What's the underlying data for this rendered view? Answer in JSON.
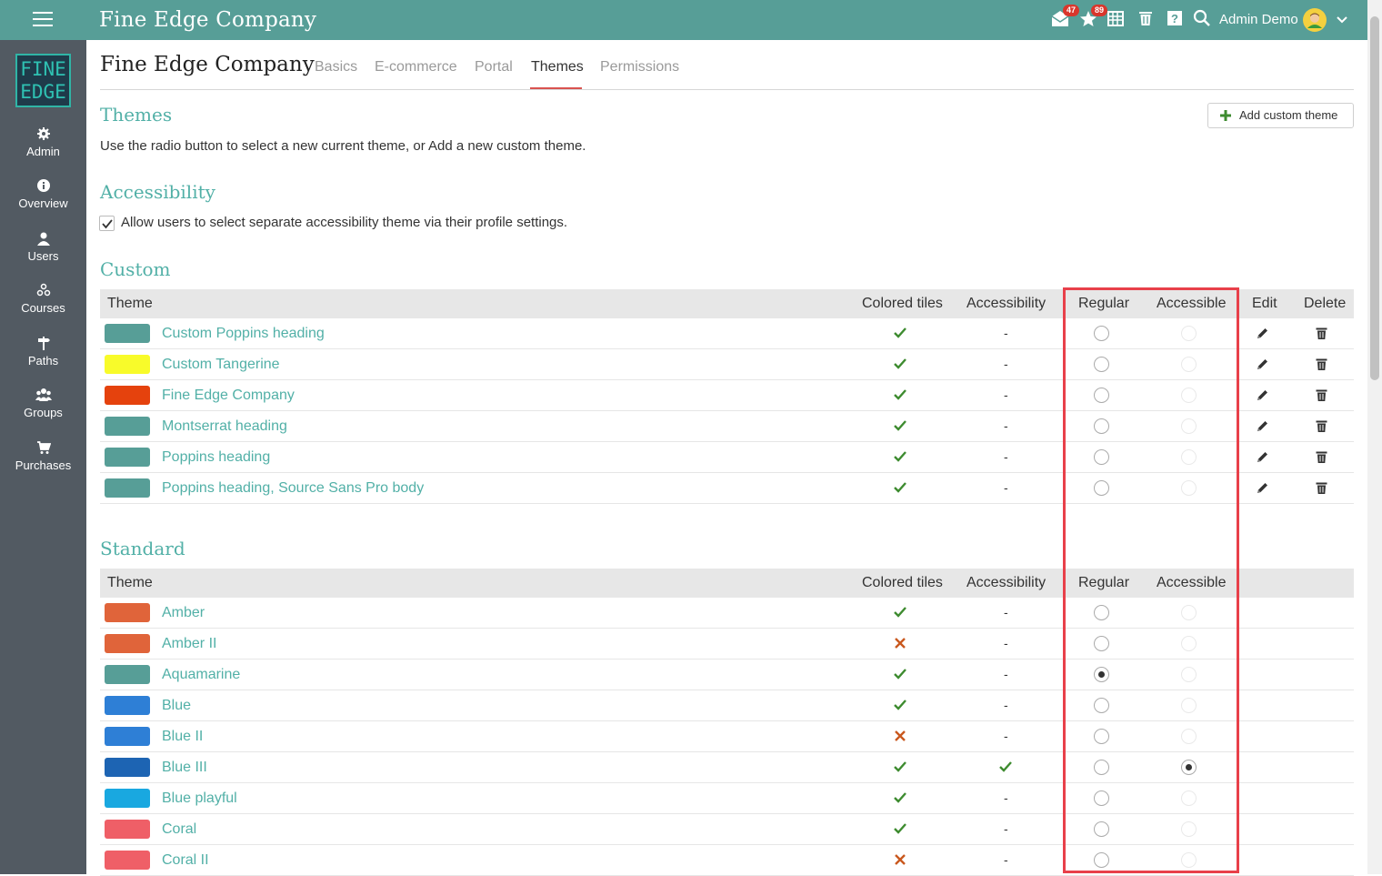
{
  "topbar": {
    "brand": "Fine Edge Company",
    "messages_badge": "47",
    "notifications_badge": "89",
    "user_name": "Admin Demo",
    "color": "#579e97"
  },
  "sidebar": {
    "logo_line1": "FINE",
    "logo_line2": "EDGE",
    "items": [
      {
        "label": "Admin",
        "icon": "gear-icon"
      },
      {
        "label": "Overview",
        "icon": "info-icon"
      },
      {
        "label": "Users",
        "icon": "user-icon"
      },
      {
        "label": "Courses",
        "icon": "courses-icon"
      },
      {
        "label": "Paths",
        "icon": "signpost-icon"
      },
      {
        "label": "Groups",
        "icon": "group-icon"
      },
      {
        "label": "Purchases",
        "icon": "cart-icon"
      }
    ]
  },
  "header": {
    "title": "Fine Edge Company",
    "tabs": [
      "Basics",
      "E-commerce",
      "Portal",
      "Themes",
      "Permissions"
    ],
    "active_tab": "Themes"
  },
  "themes_section": {
    "title": "Themes",
    "description": "Use the radio button to select a new current theme, or Add a new custom theme.",
    "add_button": "Add custom theme"
  },
  "accessibility_section": {
    "title": "Accessibility",
    "checkbox_label": "Allow users to select separate accessibility theme via their profile settings.",
    "checked": true
  },
  "columns": {
    "theme": "Theme",
    "colored_tiles": "Colored tiles",
    "accessibility": "Accessibility",
    "regular": "Regular",
    "accessible": "Accessible",
    "edit": "Edit",
    "delete": "Delete"
  },
  "custom": {
    "title": "Custom",
    "rows": [
      {
        "name": "Custom Poppins heading",
        "color": "#579e97",
        "tiles": true,
        "accessibility": "-",
        "regular": false,
        "accessible": false
      },
      {
        "name": "Custom Tangerine",
        "color": "#f8fb2a",
        "tiles": true,
        "accessibility": "-",
        "regular": false,
        "accessible": false
      },
      {
        "name": "Fine Edge Company",
        "color": "#e5420d",
        "tiles": true,
        "accessibility": "-",
        "regular": false,
        "accessible": false
      },
      {
        "name": "Montserrat heading",
        "color": "#579e97",
        "tiles": true,
        "accessibility": "-",
        "regular": false,
        "accessible": false
      },
      {
        "name": "Poppins heading",
        "color": "#579e97",
        "tiles": true,
        "accessibility": "-",
        "regular": false,
        "accessible": false
      },
      {
        "name": "Poppins heading, Source Sans Pro body",
        "color": "#579e97",
        "tiles": true,
        "accessibility": "-",
        "regular": false,
        "accessible": false
      }
    ]
  },
  "standard": {
    "title": "Standard",
    "rows": [
      {
        "name": "Amber",
        "color": "#e0643a",
        "tiles": true,
        "accessibility": "-",
        "regular": false,
        "accessible": false
      },
      {
        "name": "Amber II",
        "color": "#e0643a",
        "tiles": false,
        "accessibility": "-",
        "regular": false,
        "accessible": false
      },
      {
        "name": "Aquamarine",
        "color": "#579e97",
        "tiles": true,
        "accessibility": "-",
        "regular": true,
        "accessible": false
      },
      {
        "name": "Blue",
        "color": "#2e7fd6",
        "tiles": true,
        "accessibility": "-",
        "regular": false,
        "accessible": false
      },
      {
        "name": "Blue II",
        "color": "#2e7fd6",
        "tiles": false,
        "accessibility": "-",
        "regular": false,
        "accessible": false
      },
      {
        "name": "Blue III",
        "color": "#1d64b3",
        "tiles": true,
        "accessibility": "check",
        "regular": false,
        "accessible": true
      },
      {
        "name": "Blue playful",
        "color": "#19a8e0",
        "tiles": true,
        "accessibility": "-",
        "regular": false,
        "accessible": false
      },
      {
        "name": "Coral",
        "color": "#ef5f67",
        "tiles": true,
        "accessibility": "-",
        "regular": false,
        "accessible": false
      },
      {
        "name": "Coral II",
        "color": "#ef5f67",
        "tiles": false,
        "accessibility": "-",
        "regular": false,
        "accessible": false
      }
    ]
  },
  "colors": {
    "accent_text": "#52b0a7",
    "check": "#3d8b2f",
    "cross": "#c9581e",
    "highlight": "#e8404a",
    "sidebar": "#525a62"
  }
}
